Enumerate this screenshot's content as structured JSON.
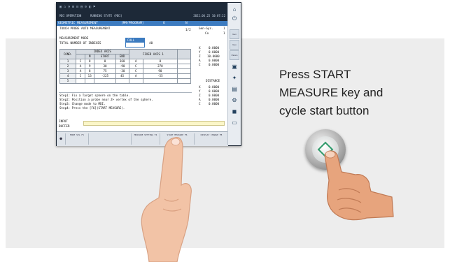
{
  "caption": {
    "line1": "Press START",
    "line2": "MEASURE key and",
    "line3": "cycle start button"
  },
  "topbar": {
    "icons": "▣ ⌂  ◔  ⊞  ⊟  ▤  ⚙  ◧  ⚑",
    "mode": "MDI OPERATION",
    "sub": "RUNNING STATE (MDI)",
    "datetime": "2022.06.25 10:07:22"
  },
  "screen": {
    "title_left": "GEOMETRIC MEASUREMENT",
    "title_mid": "[MM/PROGRAM]",
    "title_o": "O",
    "title_n": "N",
    "heading": "TOUCH PROBE AUTO MEASUREMENT",
    "page": "1/2",
    "gen_sys": "Gen-Sys.",
    "gen_sys_val": "1",
    "co_label": "Co",
    "co_val": "1",
    "mode_label": "MEASUREMENT MODE",
    "mode_value": "FULL",
    "indexes_label": "TOTAL NUMBER OF INDEXES",
    "indexes_value": "40",
    "table_headers": {
      "cond": "COND.",
      "index_axis": "INDEX AXIS",
      "fixed_axis": "FIXED AXIS 1",
      "n": "N",
      "start": "START",
      "end": "END"
    },
    "rows": [
      {
        "no": "1",
        "axis": "C",
        "n": "8",
        "start": "0",
        "end": "360",
        "faxis": "A",
        "fval": "0"
      },
      {
        "no": "2",
        "axis": "A",
        "n": "9",
        "start": "30",
        "end": "-90",
        "faxis": "C",
        "fval": "270"
      },
      {
        "no": "3",
        "axis": "A",
        "n": "8",
        "start": "75",
        "end": "-30",
        "faxis": "C",
        "fval": "90"
      },
      {
        "no": "4",
        "axis": "C",
        "n": "13",
        "start": "-225",
        "end": "45",
        "faxis": "A",
        "fval": "-55"
      },
      {
        "no": "5",
        "axis": "",
        "n": "",
        "start": "",
        "end": "",
        "faxis": "",
        "fval": ""
      }
    ],
    "pos": [
      {
        "axis": "X",
        "val": "0.0000"
      },
      {
        "axis": "Y",
        "val": "0.0000"
      },
      {
        "axis": "Z",
        "val": "10.0000"
      },
      {
        "axis": "A",
        "val": "0.0000"
      },
      {
        "axis": "C",
        "val": "0.0000"
      }
    ],
    "distance_label": "DISTANCE",
    "dist": [
      {
        "axis": "X",
        "val": "0.0000"
      },
      {
        "axis": "Y",
        "val": "0.0000"
      },
      {
        "axis": "Z",
        "val": "0.0000"
      },
      {
        "axis": "A",
        "val": "0.0000"
      },
      {
        "axis": "C",
        "val": "0.0000"
      }
    ],
    "steps": [
      "Step1: Fix a Target sphere on the table.",
      "Step2: Position a probe near Z+ vertex of the sphere.",
      "Step3: Change mode to MDI.",
      "Step4: Press the [F6](START MEASURE)."
    ],
    "input_label": "INPUT",
    "buffer_label": "BUFFER"
  },
  "softkeys": {
    "k1": "MODE SEL F1",
    "k2": "MEASURE SETTING F4",
    "k3": "START MEASURE F6",
    "k4": "DISPLAY CHANGE F8"
  },
  "sidebar": {
    "tab1": "Gen",
    "tab2": "Geo",
    "tab3": "Param"
  },
  "colors": {
    "title_bar": "#3c7bc0",
    "start_diamond": "#2f9a6b"
  }
}
